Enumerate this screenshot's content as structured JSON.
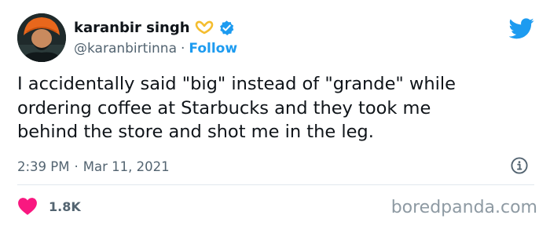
{
  "tweet": {
    "author": {
      "display_name": "karanbir singh",
      "name_emoji": "heart-hands-emoji",
      "verified": true,
      "handle": "@karanbirtinna",
      "separator": "·",
      "follow_label": "Follow"
    },
    "text_lines": [
      "I accidentally said \"big\" instead of \"grande\" while",
      "ordering coffee at Starbucks and they took me",
      "behind the store and shot me in the leg."
    ],
    "time": "2:39 PM",
    "meta_separator": "·",
    "date": "Mar 11, 2021",
    "likes": "1.8K"
  },
  "icons": {
    "brand": "twitter-bird-icon",
    "verified": "verified-badge-icon",
    "info": "info-icon",
    "like": "heart-icon"
  },
  "colors": {
    "accent": "#1d9bf0",
    "text_primary": "#0f1419",
    "text_secondary": "#536471",
    "heart": "#f91880",
    "divider": "#e1e8ed",
    "watermark": "#8e9aa3"
  },
  "watermark": "boredpanda.com"
}
